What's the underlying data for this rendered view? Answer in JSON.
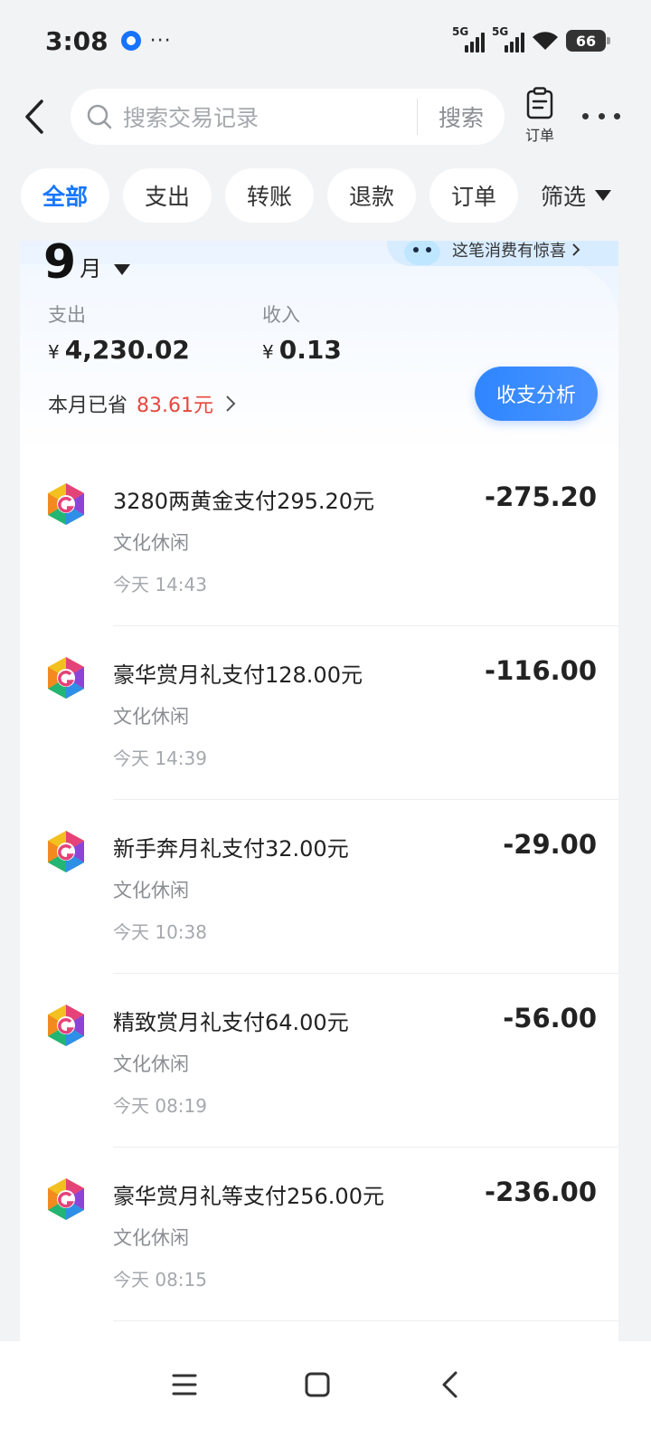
{
  "status_bar": {
    "time": "3:08",
    "more": "···",
    "network_1": "5G",
    "network_2": "5G",
    "battery": "66"
  },
  "header": {
    "search_placeholder": "搜索交易记录",
    "search_button": "搜索",
    "orders_label": "订单"
  },
  "filters": [
    {
      "label": "全部",
      "active": true
    },
    {
      "label": "支出",
      "active": false
    },
    {
      "label": "转账",
      "active": false
    },
    {
      "label": "退款",
      "active": false
    },
    {
      "label": "订单",
      "active": false
    }
  ],
  "filter_more_label": "筛选",
  "summary": {
    "month_number": "9",
    "month_unit": "月",
    "promo_text": "这笔消费有惊喜",
    "expense_label": "支出",
    "expense_currency": "¥",
    "expense_value": "4,230.02",
    "income_label": "收入",
    "income_currency": "¥",
    "income_value": "0.13",
    "saved_label": "本月已省",
    "saved_amount": "83.61元",
    "analysis_button": "收支分析"
  },
  "transactions": [
    {
      "title": "3280两黄金支付295.20元",
      "category": "文化休闲",
      "time": "今天 14:43",
      "amount": "-275.20"
    },
    {
      "title": "豪华赏月礼支付128.00元",
      "category": "文化休闲",
      "time": "今天 14:39",
      "amount": "-116.00"
    },
    {
      "title": "新手奔月礼支付32.00元",
      "category": "文化休闲",
      "time": "今天 10:38",
      "amount": "-29.00"
    },
    {
      "title": "精致赏月礼支付64.00元",
      "category": "文化休闲",
      "time": "今天 08:19",
      "amount": "-56.00"
    },
    {
      "title": "豪华赏月礼等支付256.00元",
      "category": "文化休闲",
      "time": "今天 08:15",
      "amount": "-236.00"
    }
  ],
  "colors": {
    "accent": "#1677ff",
    "saved_amount": "#e5483c",
    "page_background": "#f2f3f5"
  }
}
